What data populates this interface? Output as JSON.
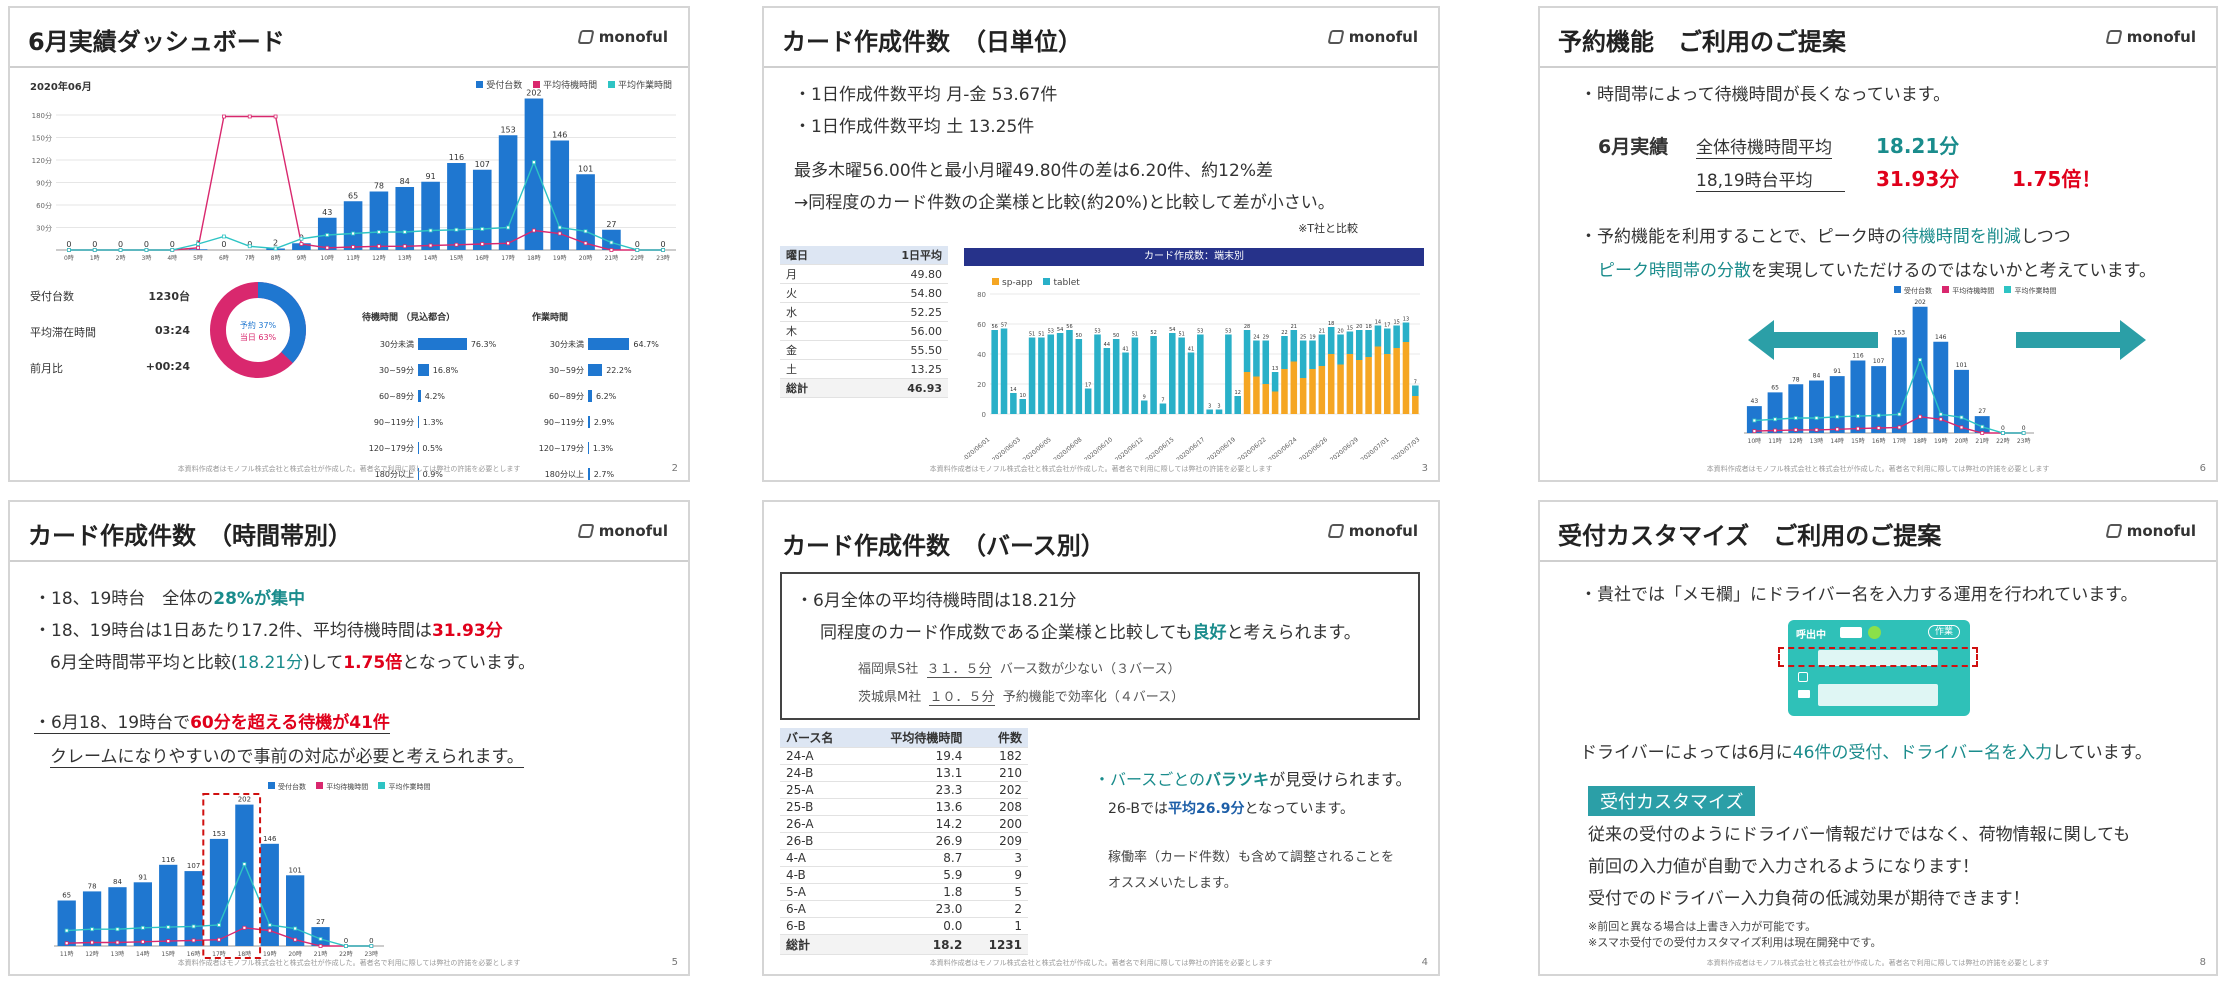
{
  "logo_text": "monoful",
  "footer_text": "本資料作成者はモノフル株式会社と株式会社が作成した。著者名で利用に際しては弊社の許諾を必要とします",
  "colors": {
    "bar": "#1f77d0",
    "wait": "#d9286e",
    "work": "#2ec4c4",
    "tablet": "#29b0c8",
    "spapp": "#f5a623",
    "teal": "#1a8c8c",
    "red": "#e0001b",
    "banner": "#2b9fa7"
  },
  "hours": [
    "0時",
    "1時",
    "2時",
    "3時",
    "4時",
    "5時",
    "6時",
    "7時",
    "8時",
    "9時",
    "10時",
    "11時",
    "12時",
    "13時",
    "14時",
    "15時",
    "16時",
    "17時",
    "18時",
    "19時",
    "20時",
    "21時",
    "22時",
    "23時"
  ],
  "legend": {
    "count": "受付台数",
    "wait": "平均待機時間",
    "work": "平均作業時間"
  },
  "s1": {
    "title": "6月実績ダッシュボード",
    "page": "2",
    "period": "2020年06月",
    "yticks": [
      "180分",
      "150分",
      "120分",
      "90分",
      "60分",
      "30分"
    ],
    "stats": [
      {
        "label": "受付台数",
        "value": "1230",
        "unit": "台"
      },
      {
        "label": "平均滞在時間",
        "value": "03:24",
        "unit": ""
      },
      {
        "label": "前月比",
        "value": "+00:24",
        "unit": ""
      }
    ],
    "donut": {
      "label1": "予約 37%",
      "label2": "当日 63%",
      "pct_reserved": 37
    },
    "wait_table": {
      "title": "待機時間 （見込都合）",
      "rows": [
        {
          "label": "30分未満",
          "value": "76.3%",
          "pct": 76.3
        },
        {
          "label": "30~59分",
          "value": "16.8%",
          "pct": 16.8
        },
        {
          "label": "60~89分",
          "value": "4.2%",
          "pct": 4.2
        },
        {
          "label": "90~119分",
          "value": "1.3%",
          "pct": 1.3
        },
        {
          "label": "120~179分",
          "value": "0.5%",
          "pct": 0.5
        },
        {
          "label": "180分以上",
          "value": "0.9%",
          "pct": 0.9
        }
      ]
    },
    "work_table": {
      "title": "作業時間",
      "rows": [
        {
          "label": "30分未満",
          "value": "64.7%",
          "pct": 64.7
        },
        {
          "label": "30~59分",
          "value": "22.2%",
          "pct": 22.2
        },
        {
          "label": "60~89分",
          "value": "6.2%",
          "pct": 6.2
        },
        {
          "label": "90~119分",
          "value": "2.9%",
          "pct": 2.9
        },
        {
          "label": "120~179分",
          "value": "1.3%",
          "pct": 1.3
        },
        {
          "label": "180分以上",
          "value": "2.7%",
          "pct": 2.7
        }
      ]
    }
  },
  "chart_data": [
    {
      "type": "bar",
      "title": "",
      "categories": [
        "0時",
        "1時",
        "2時",
        "3時",
        "4時",
        "5時",
        "6時",
        "7時",
        "8時",
        "9時",
        "10時",
        "11時",
        "12時",
        "13時",
        "14時",
        "15時",
        "16時",
        "17時",
        "18時",
        "19時",
        "20時",
        "21時",
        "22時",
        "23時"
      ],
      "series": [
        {
          "name": "受付台数",
          "values": [
            0,
            0,
            0,
            0,
            0,
            1,
            0,
            0,
            2,
            9,
            43,
            65,
            78,
            84,
            91,
            116,
            107,
            153,
            202,
            146,
            101,
            27,
            0,
            0
          ]
        },
        {
          "name": "平均待機時間",
          "values": [
            0,
            0,
            0,
            0,
            0,
            3,
            178,
            178,
            178,
            8,
            3,
            4,
            5,
            5,
            6,
            7,
            8,
            9,
            26,
            22,
            9,
            0,
            0,
            0
          ]
        },
        {
          "name": "平均作業時間",
          "values": [
            0,
            0,
            0,
            0,
            0,
            8,
            18,
            5,
            2,
            15,
            20,
            22,
            24,
            24,
            26,
            27,
            28,
            30,
            117,
            30,
            25,
            10,
            0,
            0
          ]
        }
      ],
      "ylim": [
        0,
        200
      ]
    },
    {
      "type": "bar",
      "title": "カード作成数：端末別",
      "categories": [
        "2020/06/01",
        "2020/06/03",
        "2020/06/05",
        "2020/06/08",
        "2020/06/10",
        "2020/06/12",
        "2020/06/15",
        "2020/06/17",
        "2020/06/19",
        "2020/06/22",
        "2020/06/24",
        "2020/06/26",
        "2020/06/29",
        "2020/07/01"
      ],
      "series": [
        {
          "name": "sp-app",
          "values": [
            0,
            0,
            0,
            0,
            0,
            0,
            0,
            0,
            0,
            0,
            0,
            0,
            0,
            0,
            0,
            0,
            0,
            0,
            0,
            0,
            0,
            0,
            0,
            0,
            0,
            0,
            0,
            28,
            25,
            20,
            15,
            30,
            35,
            24,
            30,
            32,
            40,
            33,
            40,
            36,
            38,
            45,
            40,
            44,
            48,
            12
          ]
        },
        {
          "name": "tablet",
          "values": [
            56,
            57,
            14,
            10,
            51,
            51,
            53,
            54,
            56,
            50,
            17,
            53,
            44,
            50,
            41,
            51,
            9,
            52,
            7,
            54,
            51,
            41,
            53,
            3,
            3,
            53,
            12,
            28,
            24,
            29,
            13,
            22,
            21,
            25,
            19,
            21,
            18,
            20,
            15,
            20,
            18,
            14,
            17,
            15,
            13,
            7
          ]
        }
      ],
      "ylim": [
        0,
        80
      ]
    }
  ],
  "s2": {
    "title": "カード作成件数　（日単位）",
    "page": "3",
    "bullet1": "・1日作成件数平均 月-金 53.67件",
    "bullet2": "・1日作成件数平均 土 13.25件",
    "line3": "最多木曜56.00件と最小月曜49.80件の差は6.20件、約12%差",
    "line4": "→同程度のカード件数の企業様と比較(約20%)と比較して差が小さい。",
    "note": "※T社と比較",
    "table_head": [
      "曜日",
      "1日平均"
    ],
    "table_rows": [
      [
        "月",
        "49.80"
      ],
      [
        "火",
        "54.80"
      ],
      [
        "水",
        "52.25"
      ],
      [
        "木",
        "56.00"
      ],
      [
        "金",
        "55.50"
      ],
      [
        "土",
        "13.25"
      ]
    ],
    "table_total": [
      "総計",
      "46.93"
    ],
    "chart_title": "カード作成数：端末別",
    "legend1": "sp-app",
    "legend2": "tablet",
    "yticks": [
      "80",
      "60",
      "40",
      "20",
      "0"
    ],
    "dates": [
      "2020/06/01",
      "2020/06/03",
      "2020/06/05",
      "2020/06/08",
      "2020/06/10",
      "2020/06/12",
      "2020/06/15",
      "2020/06/17",
      "2020/06/19",
      "2020/06/22",
      "2020/06/24",
      "2020/06/26",
      "2020/06/29",
      "2020/07/01",
      "2020/07/03"
    ]
  },
  "s3": {
    "title": "予約機能　ご利用のご提案",
    "page": "6",
    "line1": "・時間帯によって待機時間が長くなっています。",
    "row_label": "6月実績",
    "row1_text": "全体待機時間平均",
    "row1_value": "18.21分",
    "row2_text": "18,19時台平均",
    "row2_value": "31.93分",
    "row2_ratio": "1.75倍！",
    "p1_a": "・予約機能を利用することで、ピーク時の",
    "p1_b": "待機時間を削減",
    "p1_c": "しつつ",
    "p2_a": "ピーク時間帯の分散",
    "p2_b": "を実現していただけるのではないかと考えています。"
  },
  "s4": {
    "title": "カード作成件数　（時間帯別）",
    "page": "5",
    "l1_a": "・18、19時台　全体の",
    "l1_b": "28%が集中",
    "l2_a": "・18、19時台は1日あたり17.2件、平均待機時間は",
    "l2_b": "31.93分",
    "l3_a": "6月全時間帯平均と比較(",
    "l3_b": "18.21分",
    "l3_c": ")して",
    "l3_d": "1.75倍",
    "l3_e": "となっています。",
    "l4_a": "・6月18、19時台で",
    "l4_b": "60分を超える待機が41件",
    "l5": "クレームになりやすいので事前の対応が必要と考えられます。"
  },
  "s5": {
    "title": "カード作成件数　（バース別）",
    "page": "4",
    "box_l1": "・6月全体の平均待機時間は18.21分",
    "box_l2_a": "同程度のカード作成数である企業様と比較しても",
    "box_l2_b": "良好",
    "box_l2_c": "と考えられます。",
    "box_l3_a": "福岡県S社",
    "box_l3_b": "３１．５分",
    "box_l3_c": "バース数が少ない（３バース）",
    "box_l4_a": "茨城県M社",
    "box_l4_b": "１０．５分",
    "box_l4_c": "予約機能で効率化（４バース）",
    "table_head": [
      "バース名",
      "平均待機時間",
      "件数"
    ],
    "table_rows": [
      [
        "24-A",
        "19.4",
        "182"
      ],
      [
        "24-B",
        "13.1",
        "210"
      ],
      [
        "25-A",
        "23.3",
        "202"
      ],
      [
        "25-B",
        "13.6",
        "208"
      ],
      [
        "26-A",
        "14.2",
        "200"
      ],
      [
        "26-B",
        "26.9",
        "209"
      ],
      [
        "4-A",
        "8.7",
        "3"
      ],
      [
        "4-B",
        "5.9",
        "9"
      ],
      [
        "5-A",
        "1.8",
        "5"
      ],
      [
        "6-A",
        "23.0",
        "2"
      ],
      [
        "6-B",
        "0.0",
        "1"
      ]
    ],
    "table_total": [
      "総計",
      "18.2",
      "1231"
    ],
    "r1_a": "・バースごとの",
    "r1_b": "バラツキ",
    "r1_c": "が見受けられます。",
    "r2_a": "26-Bでは",
    "r2_b": "平均26.9分",
    "r2_c": "となっています。",
    "r3": "稼働率（カード件数）も含めて調整されることを",
    "r4": "オススメいたします。"
  },
  "s6": {
    "title": "受付カスタマイズ　ご利用のご提案",
    "page": "8",
    "l1": "・貴社では「メモ欄」にドライバー名を入力する運用を行われています。",
    "card_label": "呼出中",
    "card_badge": "作業",
    "l2_a": "ドライバーによっては6月に",
    "l2_b": "46件の受付、ドライバー名を入力",
    "l2_c": "しています。",
    "banner": "受付カスタマイズ",
    "p1": "従来の受付のようにドライバー情報だけではなく、荷物情報に関しても",
    "p2": "前回の入力値が自動で入力されるようになります！",
    "p3": "受付でのドライバー入力負荷の低減効果が期待できます！",
    "n1": "※前回と異なる場合は上書き入力が可能です。",
    "n2": "※スマホ受付での受付カスタマイズ利用は現在開発中です。"
  }
}
